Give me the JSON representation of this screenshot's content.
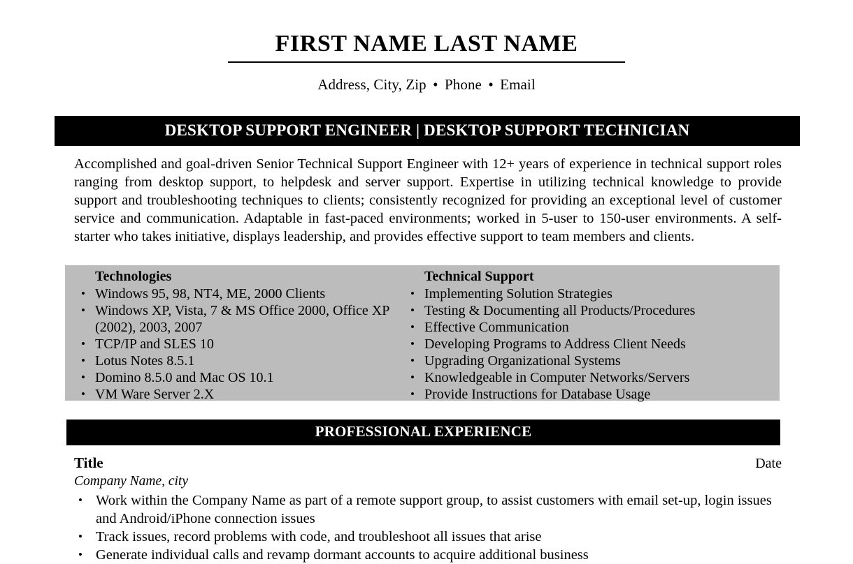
{
  "header": {
    "full_name": "FIRST NAME LAST NAME",
    "contact": {
      "address": "Address, City, Zip",
      "separator": "•",
      "phone": "Phone",
      "email": "Email"
    }
  },
  "banners": {
    "title_banner": "DESKTOP SUPPORT ENGINEER | DESKTOP SUPPORT TECHNICIAN",
    "experience_banner": "PROFESSIONAL EXPERIENCE"
  },
  "summary": "Accomplished and goal-driven Senior Technical Support Engineer with 12+ years of experience in technical support roles ranging from desktop support, to helpdesk and server support. Expertise in utilizing technical knowledge to provide support and troubleshooting techniques to clients; consistently recognized for providing an exceptional level of customer service and communication. Adaptable in fast-paced environments; worked in 5-user to 150-user environments. A self-starter who takes initiative, displays leadership, and provides effective support to team members and clients.",
  "skills": {
    "bullet_glyph": "•",
    "columns": [
      {
        "heading": "Technologies",
        "items": [
          "Windows 95, 98, NT4, ME, 2000 Clients",
          "Windows XP, Vista, 7 & MS Office 2000, Office XP (2002), 2003, 2007",
          "TCP/IP and SLES 10",
          "Lotus Notes 8.5.1",
          "Domino 8.5.0 and Mac OS 10.1",
          "VM Ware Server 2.X"
        ]
      },
      {
        "heading": "Technical Support",
        "items": [
          "Implementing Solution Strategies",
          "Testing & Documenting all Products/Procedures",
          "Effective Communication",
          "Developing Programs to Address Client Needs",
          "Upgrading Organizational Systems",
          "Knowledgeable in Computer Networks/Servers",
          "Provide Instructions for Database Usage"
        ]
      }
    ]
  },
  "experience": {
    "bullet_glyph": "•",
    "jobs": [
      {
        "title": "Title",
        "date": "Date",
        "company": "Company Name, city",
        "bullets": [
          "Work within the Company Name as part of a remote support group, to assist customers with email set-up, login issues and Android/iPhone connection issues",
          "Track issues, record problems with code, and troubleshoot all issues that arise",
          "Generate individual calls and revamp dormant accounts to acquire additional business"
        ]
      }
    ]
  },
  "colors": {
    "banner_background": "#000000",
    "banner_text": "#ffffff",
    "skills_background": "#bcbcbc",
    "page_background": "#ffffff",
    "body_text": "#000000"
  }
}
